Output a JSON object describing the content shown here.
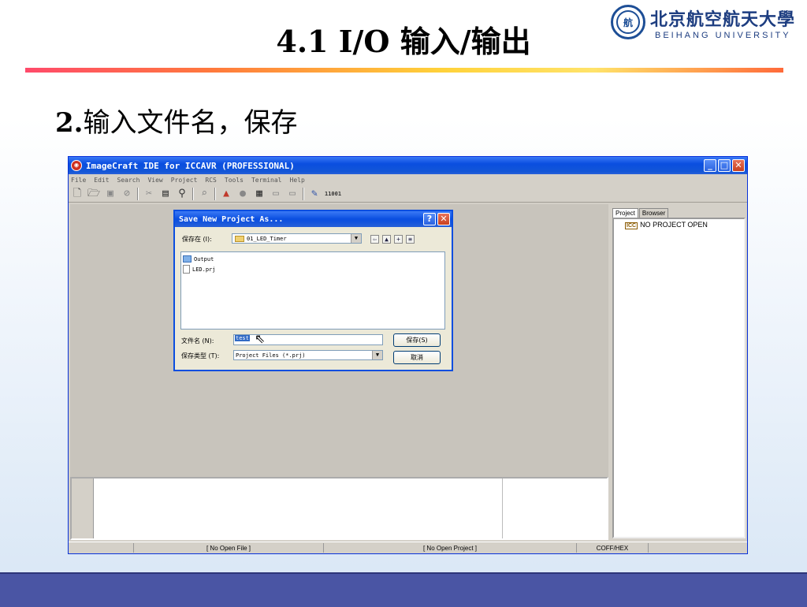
{
  "slide": {
    "title": "4.1 I/O 输入/输出",
    "subtitle_num": "2.",
    "subtitle_text": "输入文件名，保存",
    "logo_cn": "北京航空航天大學",
    "logo_en": "BEIHANG UNIVERSITY"
  },
  "ide": {
    "title": "ImageCraft IDE for ICCAVR (PROFESSIONAL)",
    "menu": [
      "File",
      "Edit",
      "Search",
      "View",
      "Project",
      "RCS",
      "Tools",
      "Terminal",
      "Help"
    ],
    "toolbar_icons": [
      "new-file-icon",
      "open-folder-icon",
      "save-icon",
      "save-all-icon",
      "cut-icon",
      "paste-icon",
      "find-icon",
      "find-next-icon",
      "build-icon",
      "stop-icon",
      "options-icon",
      "cmd-icon",
      "mem-icon",
      "programmer-icon",
      "binary-icon"
    ],
    "binary_label": "11001",
    "tabs": [
      "Project",
      "Browser"
    ],
    "tree_item": "NO PROJECT OPEN",
    "icc_label": "ICC",
    "status": [
      "[ No Open File ]",
      "[ No Open Project ]",
      "COFF/HEX"
    ]
  },
  "dialog": {
    "title": "Save New Project As...",
    "help": "?",
    "close": "✕",
    "save_in_label": "保存在 (I):",
    "save_in_value": "01_LED_Timer",
    "files": [
      "Output",
      "LED.prj"
    ],
    "filename_label": "文件名 (N):",
    "filename_value": "test",
    "filetype_label": "保存类型 (T):",
    "filetype_value": "Project Files (*.prj)",
    "save_button": "保存(S)",
    "cancel_button": "取消"
  }
}
